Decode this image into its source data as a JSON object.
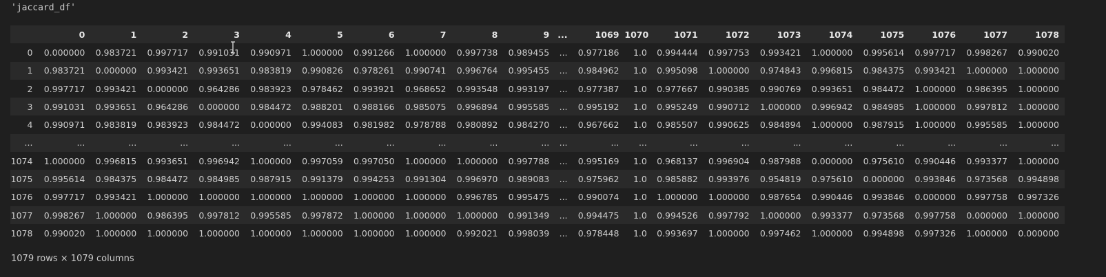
{
  "output_label": "'jaccard_df'",
  "columns": [
    "",
    "0",
    "1",
    "2",
    "3",
    "4",
    "5",
    "6",
    "7",
    "8",
    "9",
    "...",
    "1069",
    "1070",
    "1071",
    "1072",
    "1073",
    "1074",
    "1075",
    "1076",
    "1077",
    "1078"
  ],
  "rows": [
    [
      "0",
      "0.000000",
      "0.983721",
      "0.997717",
      "0.991031",
      "0.990971",
      "1.000000",
      "0.991266",
      "1.000000",
      "0.997738",
      "0.989455",
      "...",
      "0.977186",
      "1.0",
      "0.994444",
      "0.997753",
      "0.993421",
      "1.000000",
      "0.995614",
      "0.997717",
      "0.998267",
      "0.990020"
    ],
    [
      "1",
      "0.983721",
      "0.000000",
      "0.993421",
      "0.993651",
      "0.983819",
      "0.990826",
      "0.978261",
      "0.990741",
      "0.996764",
      "0.995455",
      "...",
      "0.984962",
      "1.0",
      "0.995098",
      "1.000000",
      "0.974843",
      "0.996815",
      "0.984375",
      "0.993421",
      "1.000000",
      "1.000000"
    ],
    [
      "2",
      "0.997717",
      "0.993421",
      "0.000000",
      "0.964286",
      "0.983923",
      "0.978462",
      "0.993921",
      "0.968652",
      "0.993548",
      "0.993197",
      "...",
      "0.977387",
      "1.0",
      "0.977667",
      "0.990385",
      "0.990769",
      "0.993651",
      "0.984472",
      "1.000000",
      "0.986395",
      "1.000000"
    ],
    [
      "3",
      "0.991031",
      "0.993651",
      "0.964286",
      "0.000000",
      "0.984472",
      "0.988201",
      "0.988166",
      "0.985075",
      "0.996894",
      "0.995585",
      "...",
      "0.995192",
      "1.0",
      "0.995249",
      "0.990712",
      "1.000000",
      "0.996942",
      "0.984985",
      "1.000000",
      "0.997812",
      "1.000000"
    ],
    [
      "4",
      "0.990971",
      "0.983819",
      "0.983923",
      "0.984472",
      "0.000000",
      "0.994083",
      "0.981982",
      "0.978788",
      "0.980892",
      "0.984270",
      "...",
      "0.967662",
      "1.0",
      "0.985507",
      "0.990625",
      "0.984894",
      "1.000000",
      "0.987915",
      "1.000000",
      "0.995585",
      "1.000000"
    ],
    [
      "...",
      "...",
      "...",
      "...",
      "...",
      "...",
      "...",
      "...",
      "...",
      "...",
      "...",
      "...",
      "...",
      "...",
      "...",
      "...",
      "...",
      "...",
      "...",
      "...",
      "...",
      "..."
    ],
    [
      "1074",
      "1.000000",
      "0.996815",
      "0.993651",
      "0.996942",
      "1.000000",
      "0.997059",
      "0.997050",
      "1.000000",
      "1.000000",
      "0.997788",
      "...",
      "0.995169",
      "1.0",
      "0.968137",
      "0.996904",
      "0.987988",
      "0.000000",
      "0.975610",
      "0.990446",
      "0.993377",
      "1.000000"
    ],
    [
      "1075",
      "0.995614",
      "0.984375",
      "0.984472",
      "0.984985",
      "0.987915",
      "0.991379",
      "0.994253",
      "0.991304",
      "0.996970",
      "0.989083",
      "...",
      "0.975962",
      "1.0",
      "0.985882",
      "0.993976",
      "0.954819",
      "0.975610",
      "0.000000",
      "0.993846",
      "0.973568",
      "0.994898"
    ],
    [
      "1076",
      "0.997717",
      "0.993421",
      "1.000000",
      "1.000000",
      "1.000000",
      "1.000000",
      "1.000000",
      "1.000000",
      "0.996785",
      "0.995475",
      "...",
      "0.990074",
      "1.0",
      "1.000000",
      "1.000000",
      "0.987654",
      "0.990446",
      "0.993846",
      "0.000000",
      "0.997758",
      "0.997326"
    ],
    [
      "1077",
      "0.998267",
      "1.000000",
      "0.986395",
      "0.997812",
      "0.995585",
      "0.997872",
      "1.000000",
      "1.000000",
      "1.000000",
      "0.991349",
      "...",
      "0.994475",
      "1.0",
      "0.994526",
      "0.997792",
      "1.000000",
      "0.993377",
      "0.973568",
      "0.997758",
      "0.000000",
      "1.000000"
    ],
    [
      "1078",
      "0.990020",
      "1.000000",
      "1.000000",
      "1.000000",
      "1.000000",
      "1.000000",
      "1.000000",
      "1.000000",
      "0.992021",
      "0.998039",
      "...",
      "0.978448",
      "1.0",
      "0.993697",
      "1.000000",
      "0.997462",
      "1.000000",
      "0.994898",
      "0.997326",
      "1.000000",
      "0.000000"
    ]
  ],
  "shape_text": "1079 rows × 1079 columns",
  "icons": {
    "cursor": "text-cursor-icon"
  }
}
